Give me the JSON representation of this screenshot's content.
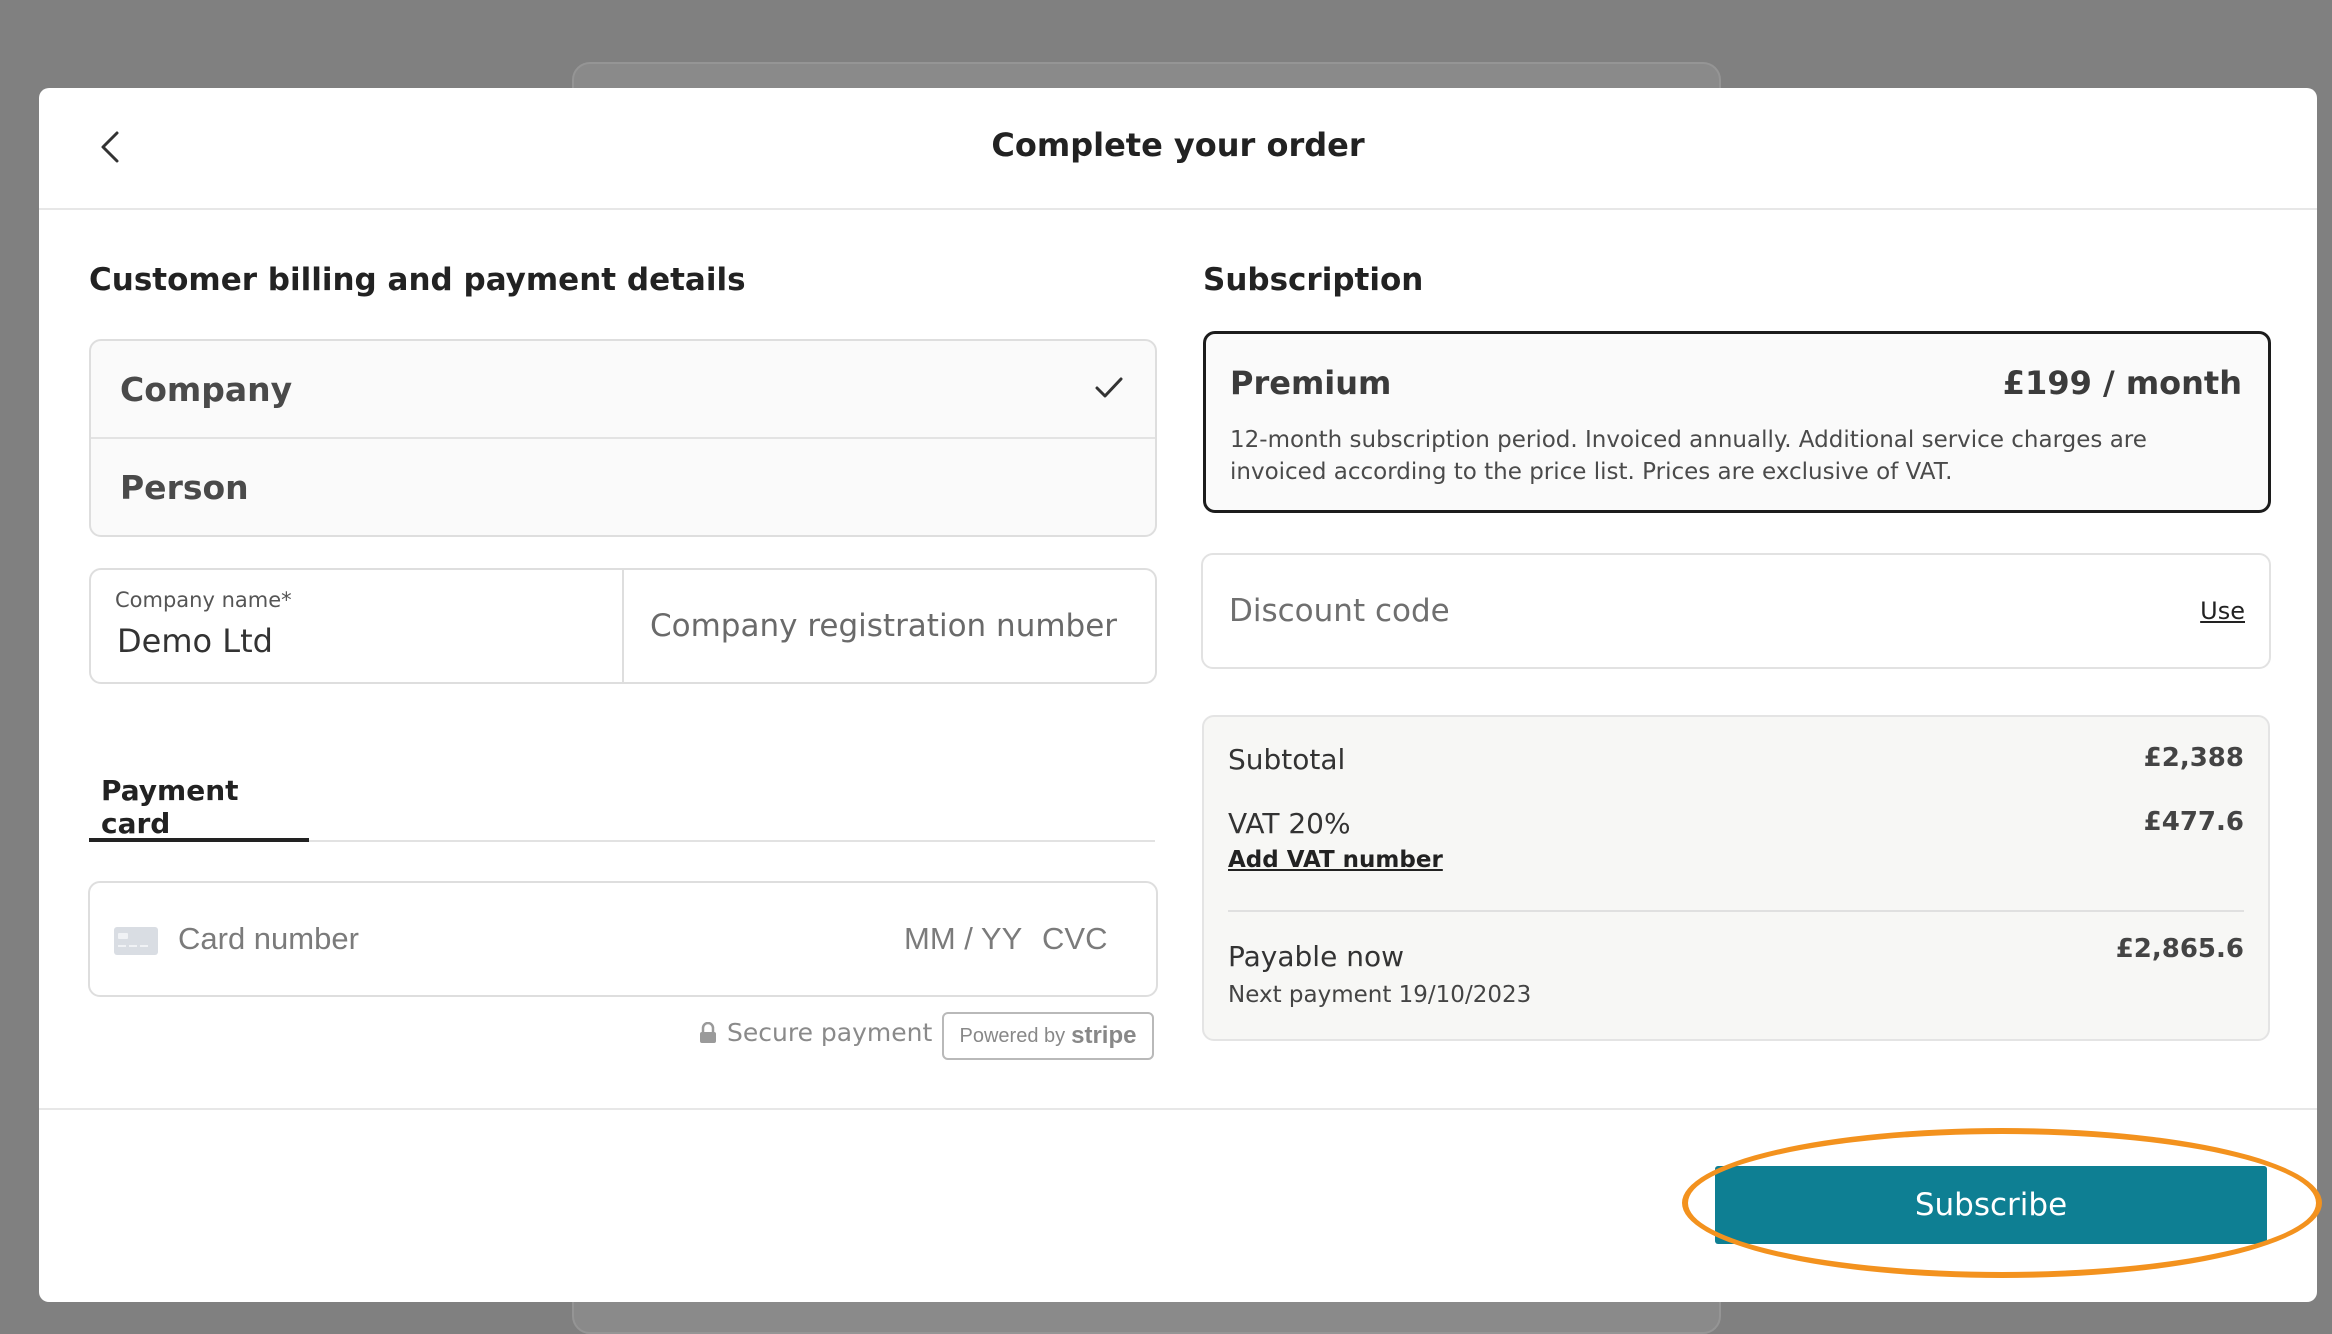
{
  "header": {
    "title": "Complete your order"
  },
  "billing": {
    "section_title": "Customer billing and payment details",
    "customer_type": {
      "options": [
        "Company",
        "Person"
      ],
      "selected": "Company"
    },
    "company_name": {
      "label": "Company name*",
      "value": "Demo Ltd"
    },
    "registration_number": {
      "placeholder": "Company registration number"
    },
    "payment_tab": {
      "label": "Payment card"
    },
    "card": {
      "number_placeholder": "Card number",
      "expiry_placeholder": "MM / YY",
      "cvc_placeholder": "CVC"
    },
    "secure_label": "Secure payment",
    "powered_by": {
      "prefix": "Powered by",
      "brand": "stripe"
    }
  },
  "subscription": {
    "section_title": "Subscription",
    "plan": {
      "name": "Premium",
      "price": "£199 / month",
      "description": "12-month subscription period. Invoiced annually. Additional service charges are invoiced according to the price list. Prices are exclusive of VAT."
    },
    "discount": {
      "placeholder": "Discount code",
      "action": "Use"
    },
    "summary": {
      "subtotal_label": "Subtotal",
      "subtotal_value": "£2,388",
      "vat_label": "VAT 20%",
      "vat_value": "£477.6",
      "add_vat_link": "Add VAT number",
      "payable_label": "Payable now",
      "payable_value": "£2,865.6",
      "next_payment": "Next payment 19/10/2023"
    }
  },
  "footer": {
    "subscribe_label": "Subscribe"
  },
  "colors": {
    "accent": "#0e7f93",
    "highlight": "#f3921e"
  },
  "icons": [
    "chevron-left-icon",
    "checkmark-icon",
    "credit-card-icon",
    "lock-icon"
  ]
}
